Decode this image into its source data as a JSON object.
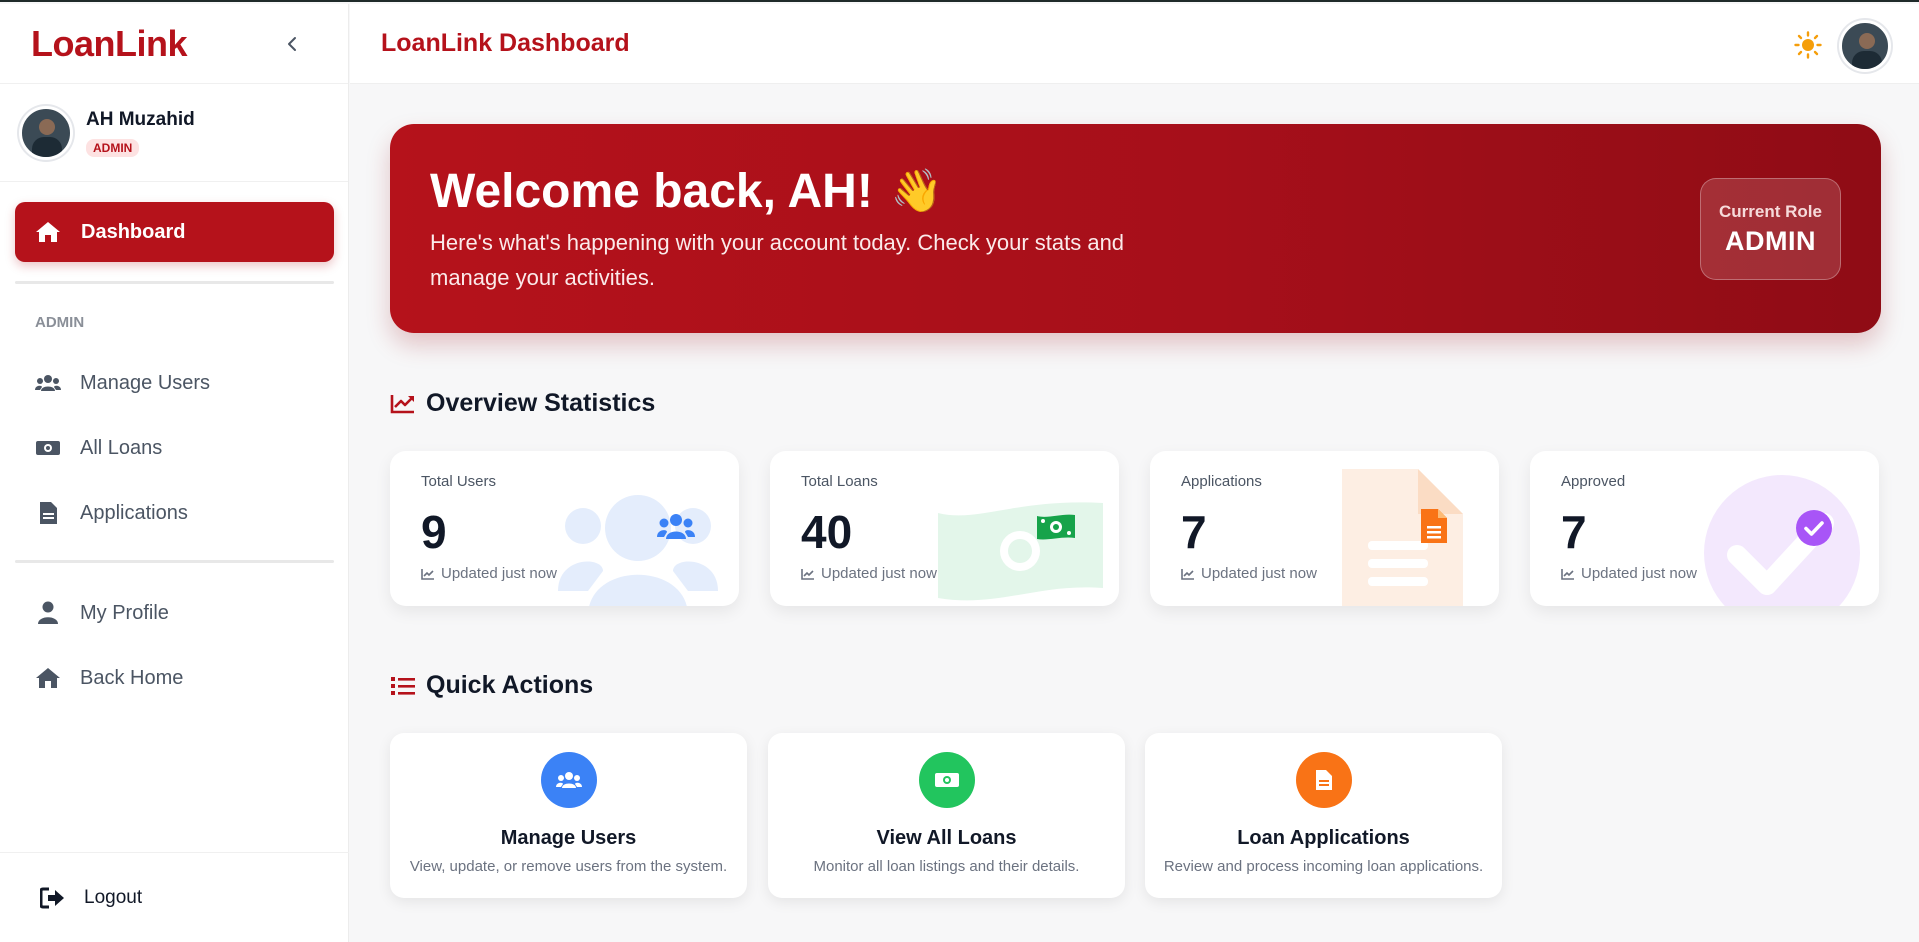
{
  "brand": "LoanLink",
  "user": {
    "name": "AH Muzahid",
    "role": "ADMIN"
  },
  "sidebar": {
    "active": {
      "label": "Dashboard",
      "icon": "home-icon"
    },
    "section_label": "ADMIN",
    "admin_items": [
      {
        "label": "Manage Users",
        "icon": "users-icon"
      },
      {
        "label": "All Loans",
        "icon": "money-icon"
      },
      {
        "label": "Applications",
        "icon": "document-icon"
      }
    ],
    "general_items": [
      {
        "label": "My Profile",
        "icon": "user-icon"
      },
      {
        "label": "Back Home",
        "icon": "home-icon"
      }
    ],
    "logout": "Logout"
  },
  "topbar": {
    "title": "LoanLink Dashboard"
  },
  "banner": {
    "title": "Welcome back, AH!",
    "emoji": "👋",
    "text": "Here's what's happening with your account today. Check your stats and manage your activities.",
    "role_label": "Current Role",
    "role_value": "ADMIN"
  },
  "overview": {
    "heading": "Overview Statistics",
    "cards": [
      {
        "label": "Total Users",
        "value": "9",
        "foot": "Updated just now",
        "icon": "users-icon",
        "color": "#3b82f6"
      },
      {
        "label": "Total Loans",
        "value": "40",
        "foot": "Updated just now",
        "icon": "money-icon",
        "color": "#16a34a"
      },
      {
        "label": "Applications",
        "value": "7",
        "foot": "Updated just now",
        "icon": "document-icon",
        "color": "#f97316"
      },
      {
        "label": "Approved",
        "value": "7",
        "foot": "Updated just now",
        "icon": "check-circle-icon",
        "color": "#a855f7"
      }
    ]
  },
  "quick_actions": {
    "heading": "Quick Actions",
    "items": [
      {
        "title": "Manage Users",
        "desc": "View, update, or remove users from the system.",
        "icon": "users-icon",
        "color": "#3b82f6"
      },
      {
        "title": "View All Loans",
        "desc": "Monitor all loan listings and their details.",
        "icon": "money-icon",
        "color": "#22c55e"
      },
      {
        "title": "Loan Applications",
        "desc": "Review and process incoming loan applications.",
        "icon": "document-icon",
        "color": "#f97316"
      }
    ]
  },
  "colors": {
    "brand": "#b5121b",
    "sun": "#f59e0b"
  }
}
